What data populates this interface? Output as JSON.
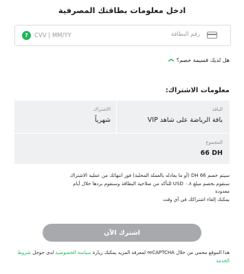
{
  "title": "ادخل معلومات بطاقتك المصرفية",
  "card": {
    "number_placeholder": "رقم البطاقة",
    "cvv_placeholder": "CVV | MM/YY",
    "help_glyph": "?"
  },
  "discount": {
    "label": "هل لديك قسيمة خصم؟",
    "chevron": "❯"
  },
  "subscription": {
    "heading": "معلومات الاشتراك:",
    "plan_label": "الباقة",
    "plan_value": "باقة الرياضة على شاهد VIP",
    "sub_label": "الاشتراك",
    "sub_value": "شهرياً",
    "total_label": "المجموع",
    "total_value": "66 DH"
  },
  "notice": {
    "line1": "سيتم خصم DH 66 (أو ما يعادله بالعملة المحلية) فور انتهائك من عملية الاشتراك",
    "line2": "سنقوم بخصم مبلغ ٠.٨ USD للتأكد من صلاحية البطاقة وسنقوم بردها خلال أيام",
    "line3": "معدودة",
    "line4": "يمكنك إلغاء اشتراكك في أي وقت"
  },
  "subscribe_button": "اشترك الآن",
  "recaptcha": {
    "text": "هذا الموقع محمي من خلال reCAPTCHA لمعرفة المزيد يمكنك زيارة",
    "privacy_link": "سياسة الخصوصية",
    "middle": "لدى جوجل",
    "terms_link": "شروط الخدمة"
  },
  "colors": {
    "accent": "#1fb75a",
    "button_disabled": "#a7a9ac",
    "panel": "#eff0f1"
  }
}
